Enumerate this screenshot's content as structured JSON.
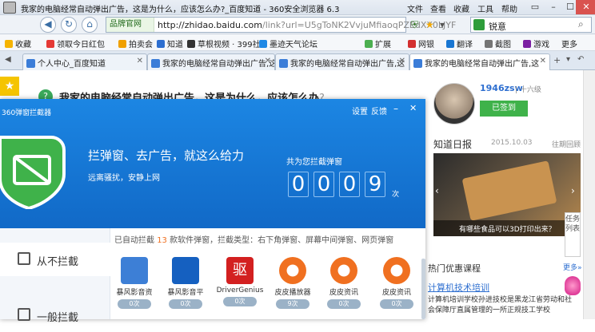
{
  "titlebar": {
    "title": "我家的电脑经常自动弹出广告，这是为什么，应该怎么办?_百度知道 - 360安全浏览器 6.3",
    "menu": [
      "文件",
      "查看",
      "收藏",
      "工具",
      "帮助"
    ],
    "win_buttons": [
      "▭",
      "–",
      "☐",
      "✕"
    ]
  },
  "navbar": {
    "back": "◀",
    "refresh": "↻",
    "home": "⌂",
    "site_tag": "品牌官网",
    "url_host": "http://zhidao.baidu.com",
    "url_rest": "/link?url=U5gToNK2VvjuMfiaoqPZEdXX0LJYF",
    "search_text": "锐意"
  },
  "bookmarks": {
    "items": [
      {
        "label": "收藏",
        "color": "#f5b301"
      },
      {
        "label": "领取今日红包",
        "color": "#e53935"
      },
      {
        "label": "拍卖会",
        "color": "#f0a000"
      },
      {
        "label": "知道",
        "color": "#2e6fd0"
      },
      {
        "label": "草根视频 · 399社",
        "color": "#333333"
      },
      {
        "label": "墨迹天气论坛",
        "color": "#1e88e5"
      }
    ],
    "right": [
      {
        "label": "扩展",
        "color": "#4caf50"
      },
      {
        "label": "网银",
        "color": "#d32f2f"
      },
      {
        "label": "翻译",
        "color": "#1976d2"
      },
      {
        "label": "截图",
        "color": "#757575"
      },
      {
        "label": "游戏",
        "color": "#7b1fa2"
      },
      {
        "label": "更多",
        "color": "#555555"
      }
    ]
  },
  "tabs": [
    {
      "label": "个人中心_百度知道",
      "active": false
    },
    {
      "label": "我家的电脑经常自动弹出广告,这",
      "active": false
    },
    {
      "label": "我家的电脑经常自动弹出广告,这",
      "active": false
    },
    {
      "label": "我家的电脑经常自动弹出广告,这",
      "active": true
    }
  ],
  "question": {
    "title": "我家的电脑经常自动弹出广告，这是为什么，应该怎么办",
    "help": "?"
  },
  "popup": {
    "app_name": "360弹窗拦截器",
    "settings": "设置",
    "feedback": "反馈",
    "minimize": "–",
    "close": "✕",
    "slogan": "拦弹窗、去广告，就这么给力",
    "sub": "远离骚扰，安静上网",
    "count_label": "共为您拦截弹窗",
    "digits": [
      "0",
      "0",
      "0",
      "9"
    ],
    "count_unit": "次",
    "summary_pre": "已自动拦截",
    "summary_num": "13",
    "summary_post": "款软件弹窗，拦截类型：右下角弹窗、屏幕中间弹窗、网页弹窗",
    "side": [
      {
        "label": "从不拦截"
      },
      {
        "label": "一般拦截"
      }
    ],
    "apps": [
      {
        "label": "暴风影音资",
        "count": "0次",
        "icon": "grid-icon",
        "color": "#3d7fd6"
      },
      {
        "label": "暴风影音平",
        "count": "0次",
        "icon": "film-icon",
        "color": "#1560c0"
      },
      {
        "label": "DriverGenius",
        "count": "0次",
        "icon": "驱",
        "color": "#d32020"
      },
      {
        "label": "皮皮播放器",
        "count": "9次",
        "icon": "play-icon",
        "color": "#f07020"
      },
      {
        "label": "皮皮资讯",
        "count": "0次",
        "icon": "play-icon",
        "color": "#f07020"
      },
      {
        "label": "皮皮资讯",
        "count": "0次",
        "icon": "play-icon",
        "color": "#f07020"
      }
    ]
  },
  "rpanel": {
    "username": "1946zsw",
    "level": "十六级",
    "checkin": "已签到",
    "daily_title": "知道日报",
    "daily_date": "2015.10.03",
    "daily_more": "往期回顾",
    "banner_caption": "有哪些食品可以3D打印出来？",
    "task_list": "任务列表",
    "hot_title": "热门优惠课程",
    "hot_more": "更多»",
    "course_link": "计算机技术培训",
    "course_text": "计算机培训学校孙进技校是黑龙江省劳动和社会保障厅直属管理的一所正规技工学校"
  }
}
